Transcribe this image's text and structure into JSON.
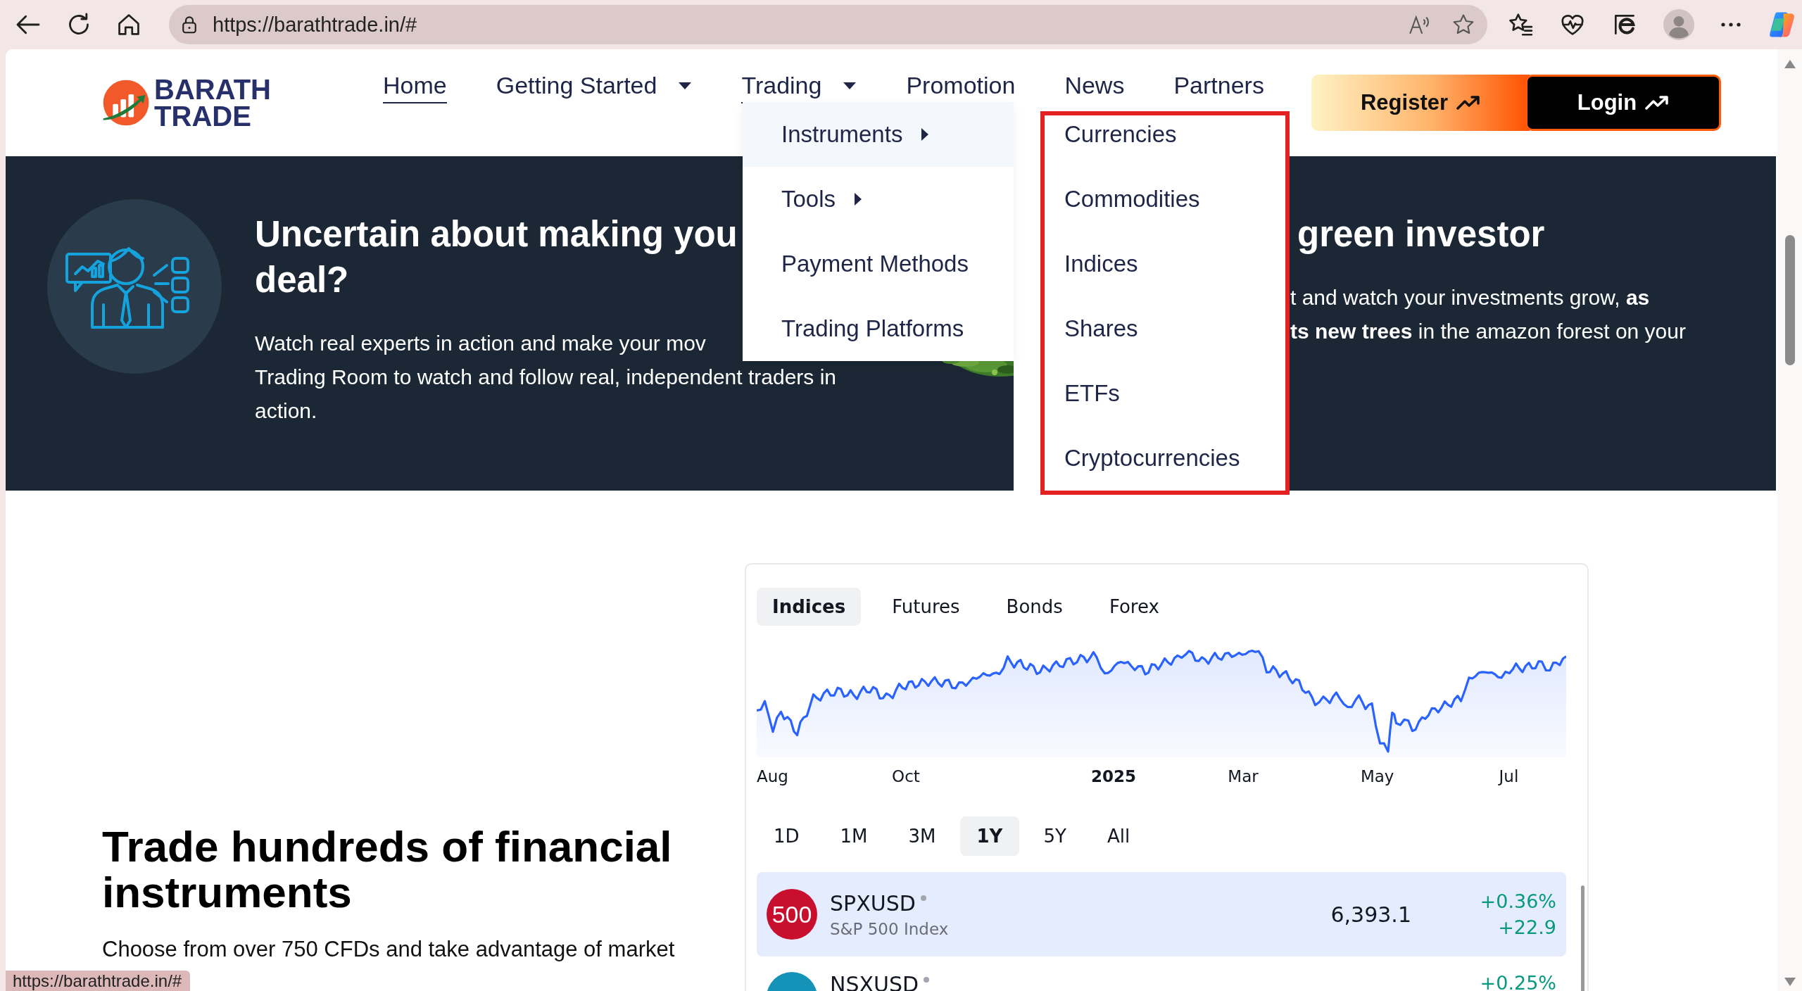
{
  "browser": {
    "url": "https://barathtrade.in/#"
  },
  "logo": {
    "lines": [
      "BARATH",
      "TRADE"
    ]
  },
  "nav": {
    "items": [
      {
        "label": "Home",
        "selected": true,
        "has_menu": false
      },
      {
        "label": "Getting Started",
        "selected": false,
        "has_menu": true
      },
      {
        "label": "Trading",
        "selected": true,
        "has_menu": true
      },
      {
        "label": "Promotion",
        "selected": false,
        "has_menu": false
      },
      {
        "label": "News",
        "selected": false,
        "has_menu": false
      },
      {
        "label": "Partners",
        "selected": false,
        "has_menu": false
      }
    ]
  },
  "auth_buttons": [
    {
      "label": "Register",
      "kind": "gradient"
    },
    {
      "label": "Login",
      "kind": "dark"
    }
  ],
  "trading_menu": {
    "items": [
      {
        "label": "Instruments",
        "has_submenu": true,
        "expanded": true
      },
      {
        "label": "Tools",
        "has_submenu": true,
        "expanded": false
      },
      {
        "label": "Payment Methods",
        "has_submenu": false,
        "expanded": false
      },
      {
        "label": "Trading Platforms",
        "has_submenu": false,
        "expanded": false
      }
    ]
  },
  "instruments_menu": {
    "items": [
      "Currencies",
      "Commodities",
      "Indices",
      "Shares",
      "ETFs",
      "Cryptocurrencies"
    ]
  },
  "hero_cards": [
    {
      "title_lines": [
        "Uncertain about making you",
        "deal?"
      ],
      "text_lines": [
        "Watch real experts in action and make your mov",
        "Trading Room to watch and follow real, independent traders in",
        "action."
      ]
    },
    {
      "title_lines": [
        "green investor"
      ],
      "text_lines": [
        "t and watch your investments grow, **as**",
        "**ts new trees** in the amazon forest on your"
      ]
    }
  ],
  "section": {
    "title": "Trade hundreds of financial instruments",
    "text": "Choose from over 750 CFDs and take advantage of market"
  },
  "market_widget": {
    "tabs": [
      {
        "label": "Indices",
        "selected": true
      },
      {
        "label": "Futures",
        "selected": false
      },
      {
        "label": "Bonds",
        "selected": false
      },
      {
        "label": "Forex",
        "selected": false
      }
    ],
    "axis_labels": [
      {
        "label": "Aug",
        "kind": "month"
      },
      {
        "label": "Oct",
        "kind": "month"
      },
      {
        "label": "2025",
        "kind": "year"
      },
      {
        "label": "Mar",
        "kind": "month"
      },
      {
        "label": "May",
        "kind": "month"
      },
      {
        "label": "Jul",
        "kind": "month"
      }
    ],
    "ranges": [
      {
        "label": "1D",
        "selected": false
      },
      {
        "label": "1M",
        "selected": false
      },
      {
        "label": "3M",
        "selected": false
      },
      {
        "label": "1Y",
        "selected": true
      },
      {
        "label": "5Y",
        "selected": false
      },
      {
        "label": "All",
        "selected": false
      }
    ],
    "rows": [
      {
        "symbol": "SPXUSD",
        "name": "S&P 500 Index",
        "badge": "500",
        "color": "#c8102e",
        "price": "6,393.1",
        "change_pct": "+0.36%",
        "change_abs": "+22.9",
        "selected": true
      },
      {
        "symbol": "NSXUSD",
        "color": "#1592b8",
        "change_pct": "+0.25%",
        "selected": false
      }
    ]
  },
  "status_tip": "https://barathtrade.in/#"
}
